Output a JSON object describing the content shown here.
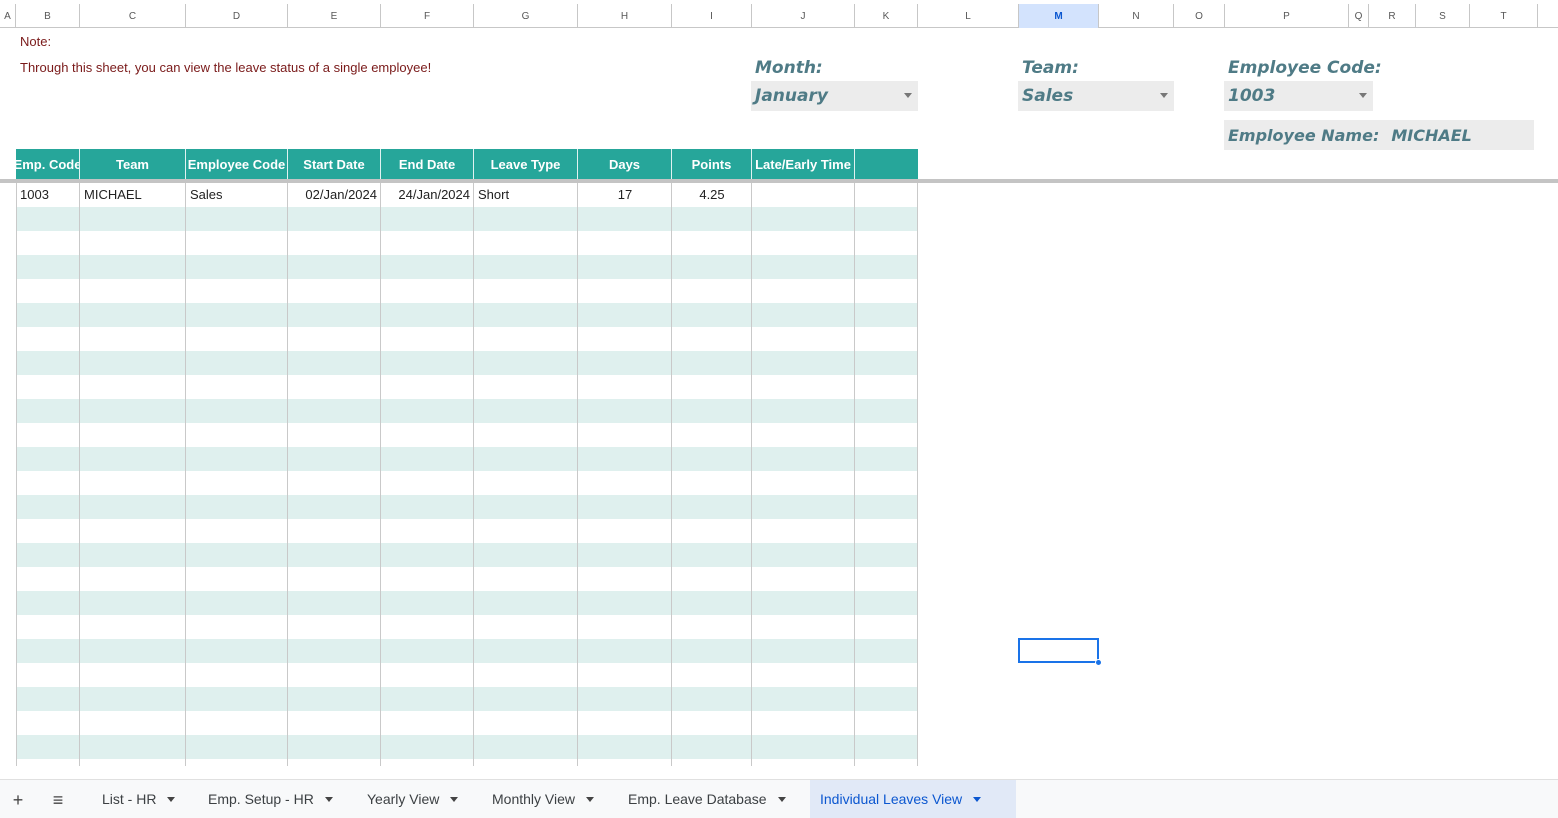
{
  "columns": [
    "A",
    "B",
    "C",
    "D",
    "E",
    "F",
    "G",
    "H",
    "I",
    "J",
    "K",
    "L",
    "M",
    "N",
    "O",
    "P",
    "Q",
    "R",
    "S",
    "T"
  ],
  "selected_column": "M",
  "note": {
    "title": "Note:",
    "text": "Through this sheet, you can view the leave status of a single employee!"
  },
  "filters": {
    "month_label": "Month:",
    "month_value": "January",
    "team_label": "Team:",
    "team_value": "Sales",
    "code_label": "Employee Code:",
    "code_value": "1003",
    "name_label": "Employee Name:",
    "name_value": "MICHAEL"
  },
  "table": {
    "headers": [
      "Emp. Code",
      "Team",
      "Employee Code",
      "Start Date",
      "End Date",
      "Leave Type",
      "Days",
      "Points",
      "Late/Early Time",
      ""
    ],
    "rows": [
      [
        "1003",
        "MICHAEL",
        "Sales",
        "02/Jan/2024",
        "24/Jan/2024",
        "Short",
        "17",
        "4.25",
        "",
        ""
      ]
    ]
  },
  "colors": {
    "header_bg": "#26a69a",
    "band": "#dff0ee",
    "accent": "#1a73e8"
  },
  "tabs": {
    "add_icon": "+",
    "menu_icon": "≡",
    "items": [
      "List - HR",
      "Emp. Setup - HR",
      "Yearly View",
      "Monthly View",
      "Emp. Leave Database",
      "Individual Leaves View"
    ],
    "active": "Individual Leaves View"
  }
}
